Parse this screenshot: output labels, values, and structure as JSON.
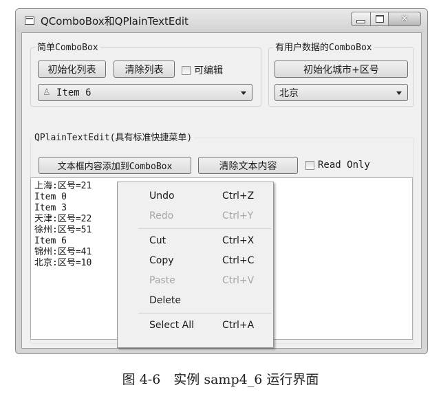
{
  "window": {
    "title": "QComboBox和QPlainTextEdit"
  },
  "simple_group": {
    "title": "简单ComboBox",
    "init_button": "初始化列表",
    "clear_button": "清除列表",
    "editable_label": "可编辑",
    "combo_value": "Item 6"
  },
  "userdata_group": {
    "title": "有用户数据的ComboBox",
    "init_button": "初始化城市+区号",
    "combo_value": "北京"
  },
  "textedit_group": {
    "title": "QPlainTextEdit(具有标准快捷菜单)",
    "add_button": "文本框内容添加到ComboBox",
    "clear_button": "清除文本内容",
    "readonly_label": "Read Only",
    "lines": [
      "上海:区号=21",
      "Item 0",
      "Item 3",
      "天津:区号=22",
      "徐州:区号=51",
      "Item 6",
      "锦州:区号=41",
      "北京:区号=10"
    ]
  },
  "context_menu": {
    "undo": {
      "label": "Undo",
      "shortcut": "Ctrl+Z"
    },
    "redo": {
      "label": "Redo",
      "shortcut": "Ctrl+Y"
    },
    "cut": {
      "label": "Cut",
      "shortcut": "Ctrl+X"
    },
    "copy": {
      "label": "Copy",
      "shortcut": "Ctrl+C"
    },
    "paste": {
      "label": "Paste",
      "shortcut": "Ctrl+V"
    },
    "delete": {
      "label": "Delete"
    },
    "select_all": {
      "label": "Select All",
      "shortcut": "Ctrl+A"
    }
  },
  "figure_caption": "图 4-6　实例 samp4_6 运行界面",
  "icons": {
    "app": "app-window-icon",
    "minimize": "minimize-icon",
    "maximize": "maximize-icon",
    "close": "close-icon",
    "combo_item": "person-icon",
    "dropdown": "chevron-down-icon",
    "close_glyph": "✕"
  },
  "colors": {
    "window_bg": "#f0f0f0",
    "disabled_text": "#a6a6a6"
  }
}
